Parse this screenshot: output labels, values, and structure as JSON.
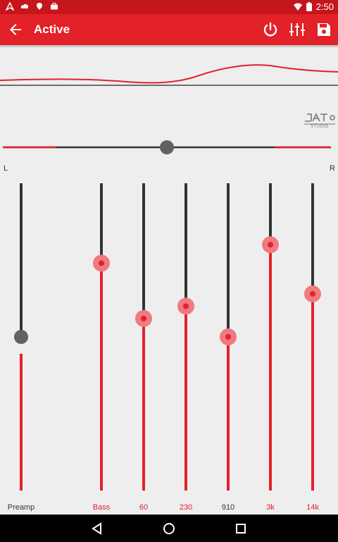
{
  "status_bar": {
    "time": "2:50",
    "icons": [
      "navigation-icon",
      "cloud-icon",
      "location-pin-icon",
      "briefcase-icon",
      "wifi-icon",
      "battery-icon"
    ]
  },
  "app_bar": {
    "title": "Active",
    "back_icon": "arrow-back-icon",
    "actions": [
      "power-icon",
      "equalizer-settings-icon",
      "save-icon"
    ]
  },
  "logo_text": "JAT STUDIO",
  "balance": {
    "left_label": "L",
    "right_label": "R",
    "value": 0.5
  },
  "bands": [
    {
      "label": "Preamp",
      "level": 0.5,
      "label_color": "#333333",
      "enabled": false
    },
    {
      "label": "Bass",
      "level": 0.74,
      "label_color": "#e32129",
      "enabled": true
    },
    {
      "label": "60",
      "level": 0.56,
      "label_color": "#e32129",
      "enabled": true
    },
    {
      "label": "230",
      "level": 0.6,
      "label_color": "#e32129",
      "enabled": true
    },
    {
      "label": "910",
      "level": 0.5,
      "label_color": "#333333",
      "enabled": true
    },
    {
      "label": "3k",
      "level": 0.8,
      "label_color": "#e32129",
      "enabled": true
    },
    {
      "label": "14k",
      "level": 0.64,
      "label_color": "#e32129",
      "enabled": true
    }
  ],
  "colors": {
    "accent": "#e32129",
    "status_bar": "#c4161c",
    "track_dark": "#333333",
    "background": "#eeeeee"
  },
  "nav_bar": [
    "back-triangle-icon",
    "home-circle-icon",
    "recents-square-icon"
  ]
}
